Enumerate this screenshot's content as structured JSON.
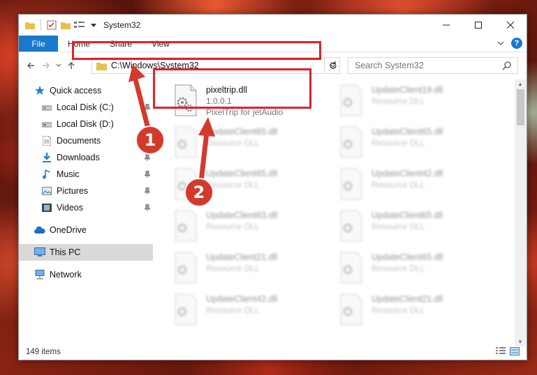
{
  "window": {
    "title": "System32"
  },
  "ribbon": {
    "file": "File",
    "tabs": [
      "Home",
      "Share",
      "View"
    ],
    "help": "?"
  },
  "nav": {
    "address": "C:\\Windows\\System32",
    "search_placeholder": "Search System32"
  },
  "sidebar": {
    "items": [
      {
        "label": "Quick access",
        "icon": "star-icon"
      },
      {
        "label": "Local Disk (C:)",
        "icon": "drive-icon"
      },
      {
        "label": "Local Disk (D:)",
        "icon": "drive-icon"
      },
      {
        "label": "Documents",
        "icon": "document-icon"
      },
      {
        "label": "Downloads",
        "icon": "download-icon"
      },
      {
        "label": "Music",
        "icon": "music-icon"
      },
      {
        "label": "Pictures",
        "icon": "picture-icon"
      },
      {
        "label": "Videos",
        "icon": "video-icon"
      },
      {
        "label": "OneDrive",
        "icon": "cloud-icon"
      },
      {
        "label": "This PC",
        "icon": "computer-icon"
      },
      {
        "label": "Network",
        "icon": "network-icon"
      }
    ]
  },
  "highlighted_file": {
    "name": "pixeltrip.dll",
    "version": "1.0.0.1",
    "description": "PixelTrip for jetAudio"
  },
  "files": [
    {
      "name": "UpdateClient65.dll",
      "type": "Resource DLL"
    },
    {
      "name": "UpdateClient65.dll",
      "type": "Resource DLL"
    },
    {
      "name": "UpdateClient63.dll",
      "type": "Resource DLL"
    },
    {
      "name": "UpdateClient21.dll",
      "type": "Resource DLL"
    },
    {
      "name": "UpdateClient42.dll",
      "type": "Resource DLL"
    },
    {
      "name": "UpdateClient19.dll",
      "type": "Resource DLL"
    },
    {
      "name": "UpdateClient65.dll",
      "type": "Resource DLL"
    },
    {
      "name": "UpdateClient42.dll",
      "type": "Resource DLL"
    },
    {
      "name": "UpdateClient65.dll",
      "type": "Resource DLL"
    },
    {
      "name": "UpdateClient65.dll",
      "type": "Resource DLL"
    },
    {
      "name": "UpdateClient21.dll",
      "type": "Resource DLL"
    }
  ],
  "status": {
    "count": "149 items"
  },
  "annotations": {
    "step1": "1",
    "step2": "2"
  },
  "colors": {
    "accent": "#1979ca",
    "highlight": "#e0222a",
    "badge": "#d33a2c"
  }
}
